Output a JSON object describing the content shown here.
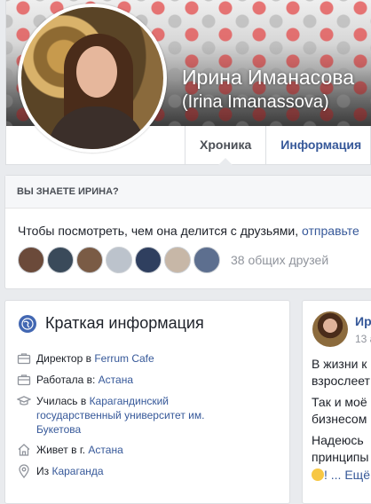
{
  "profile": {
    "name": "Ирина Иманасова",
    "name_latin": "(Irina Imanassova)",
    "tabs": [
      {
        "label": "Хроника",
        "active": true
      },
      {
        "label": "Информация",
        "active": false
      }
    ]
  },
  "know_card": {
    "header": "ВЫ ЗНАЕТЕ ИРИНА?",
    "text": "Чтобы посмотреть, чем она делится с друзьями, ",
    "link": "отправьте",
    "mutual_friends": "38 общих друзей",
    "friend_colors": [
      "#6b4a3a",
      "#3a4a5a",
      "#7a5b45",
      "#bcc3cc",
      "#2f3f5f",
      "#c7b7a7",
      "#5d6f8f"
    ]
  },
  "intro": {
    "title": "Краткая информация",
    "items": [
      {
        "icon": "briefcase-icon",
        "prefix": "Директор в ",
        "link": "Ferrum Cafe",
        "suffix": ""
      },
      {
        "icon": "briefcase-icon",
        "prefix": "Работала в: ",
        "link": "Астана",
        "suffix": ""
      },
      {
        "icon": "graduation-cap-icon",
        "prefix": "Училась в ",
        "link": "Карагандинский государственный университет им. Букетова",
        "suffix": ""
      },
      {
        "icon": "home-icon",
        "prefix": "Живет в г. ",
        "link": "Астана",
        "suffix": ""
      },
      {
        "icon": "location-pin-icon",
        "prefix": "Из ",
        "link": "Караганда",
        "suffix": ""
      }
    ]
  },
  "post": {
    "author": "Ири",
    "date": "13 а",
    "lines": [
      "В жизни к",
      "взрослеет",
      "Так и моё",
      "бизнесом",
      "Надеюсь",
      "принципы",
      "! ... Ещё"
    ]
  },
  "colors": {
    "link": "#365899",
    "page_bg": "#e9ebee",
    "card_border": "#dddfe2",
    "globe": "#4267b2"
  }
}
